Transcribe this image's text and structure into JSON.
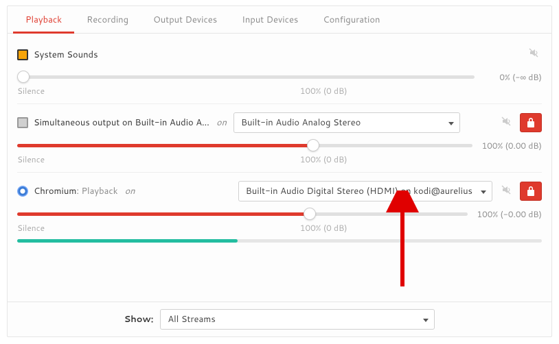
{
  "tabs": {
    "playback": "Playback",
    "recording": "Recording",
    "output": "Output Devices",
    "input": "Input Devices",
    "config": "Configuration"
  },
  "streams": {
    "system": {
      "name": "System Sounds",
      "percent": 0,
      "readout": "0% (-∞ dB)",
      "silence": "Silence",
      "center": "100% (0 dB)"
    },
    "sim": {
      "name": "Simultaneous output on Built-in Audio A…",
      "on": "on",
      "device": "Built-in Audio Analog Stereo",
      "percent": 65,
      "readout": "100% (0.00 dB)",
      "silence": "Silence",
      "center": "100% (0 dB)"
    },
    "chromium": {
      "app": "Chromium",
      "sub": ": Playback",
      "on": "on",
      "device": "Built-in Audio Digital Stereo (HDMI) on kodi@aurelius",
      "percent": 65,
      "readout": "100% (-0.00 dB)",
      "silence": "Silence",
      "center": "100% (0 dB)",
      "meter_pct": 42
    }
  },
  "footer": {
    "show_label": "Show:",
    "filter": "All Streams"
  }
}
